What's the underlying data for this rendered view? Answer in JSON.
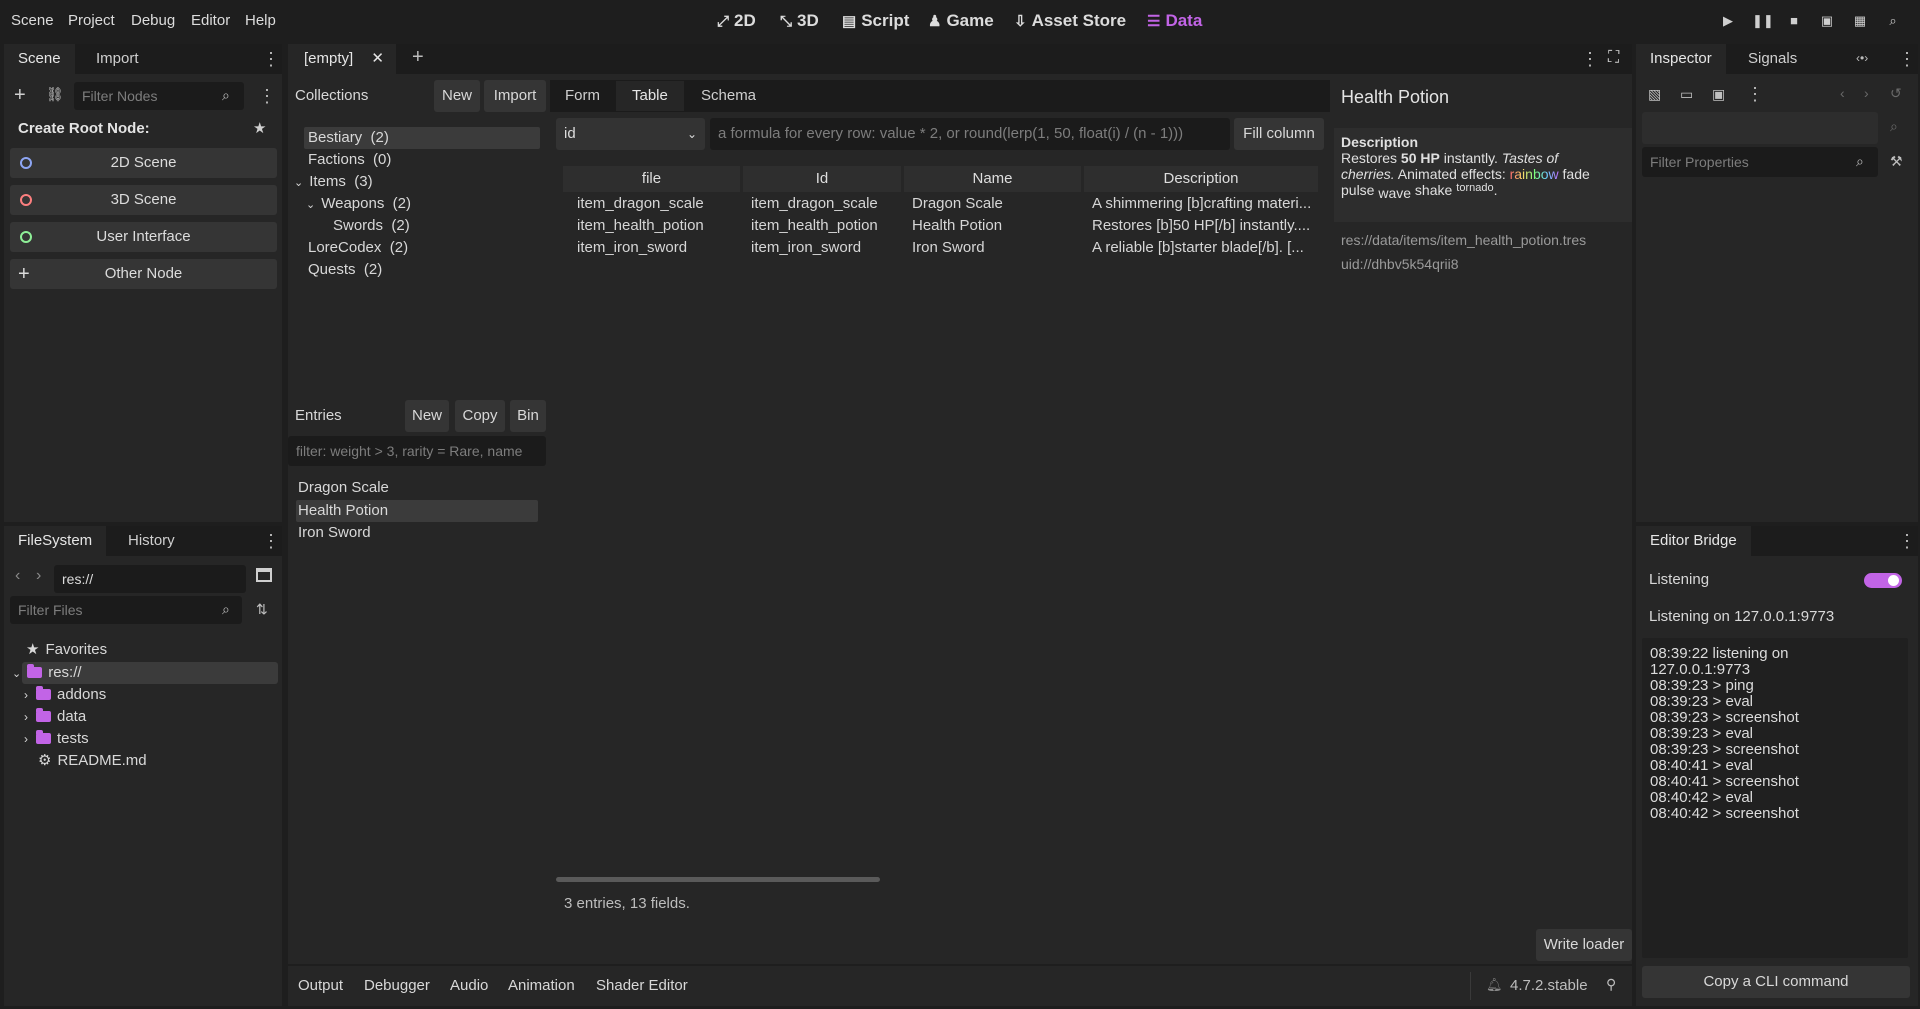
{
  "menubar": {
    "menus": [
      "Scene",
      "Project",
      "Debug",
      "Editor",
      "Help"
    ],
    "workspaces": [
      {
        "icon": "2d-icon",
        "label": "2D"
      },
      {
        "icon": "3d-icon",
        "label": "3D"
      },
      {
        "icon": "script-icon",
        "label": "Script"
      },
      {
        "icon": "game-icon",
        "label": "Game"
      },
      {
        "icon": "asset-store-icon",
        "label": "Asset Store"
      },
      {
        "icon": "data-icon",
        "label": "Data"
      }
    ],
    "accent": "#c264e6"
  },
  "scene_dock": {
    "tabs": [
      "Scene",
      "Import"
    ],
    "filter_placeholder": "Filter Nodes",
    "create_root_label": "Create Root Node:",
    "root_buttons": [
      {
        "label": "2D Scene",
        "color": "#8da5f3"
      },
      {
        "label": "3D Scene",
        "color": "#fc7f7f"
      },
      {
        "label": "User Interface",
        "color": "#8eef97"
      },
      {
        "label": "Other Node",
        "color": "#e0e0e0"
      }
    ]
  },
  "filesystem_dock": {
    "tabs": [
      "FileSystem",
      "History"
    ],
    "path": "res://",
    "filter_placeholder": "Filter Files",
    "favorites_label": "Favorites",
    "root_label": "res://",
    "items": [
      "addons",
      "data",
      "tests"
    ],
    "readme": "README.md"
  },
  "editor_tabs": {
    "current": "[empty]"
  },
  "data_editor": {
    "collections_label": "Collections",
    "new_label": "New",
    "import_label": "Import",
    "view_tabs": [
      "Form",
      "Table",
      "Schema"
    ],
    "collections": [
      {
        "label": "Bestiary",
        "count": "(2)"
      },
      {
        "label": "Factions",
        "count": "(0)"
      },
      {
        "label": "Items",
        "count": "(3)"
      },
      {
        "label": "Weapons",
        "count": "(2)"
      },
      {
        "label": "Swords",
        "count": "(2)"
      },
      {
        "label": "LoreCodex",
        "count": "(2)"
      },
      {
        "label": "Quests",
        "count": "(2)"
      }
    ],
    "entries_label": "Entries",
    "entries_new": "New",
    "entries_copy": "Copy",
    "entries_bin": "Bin",
    "entries_filter_placeholder": "filter: weight > 3, rarity = Rare, name",
    "entries": [
      "Dragon Scale",
      "Health Potion",
      "Iron Sword"
    ],
    "column_select": "id",
    "formula_placeholder": "a formula for every row: value * 2, or round(lerp(1, 50, float(i) / (n - 1)))",
    "fill_column": "Fill column",
    "table": {
      "headers": [
        "file",
        "Id",
        "Name",
        "Description"
      ],
      "rows": [
        [
          "item_dragon_scale",
          "item_dragon_scale",
          "Dragon Scale",
          "A shimmering [b]crafting materi..."
        ],
        [
          "item_health_potion",
          "item_health_potion",
          "Health Potion",
          "Restores [b]50 HP[/b] instantly...."
        ],
        [
          "item_iron_sword",
          "item_iron_sword",
          "Iron Sword",
          "A reliable [b]starter blade[/b]. [..."
        ]
      ]
    },
    "status": "3 entries, 13 fields.",
    "write_loader": "Write loader"
  },
  "preview": {
    "title": "Health Potion",
    "desc_heading": "Description",
    "desc_1a": "Restores ",
    "desc_1b": "50 HP",
    "desc_1c": " instantly. ",
    "desc_1d": "Tastes of",
    "desc_2a": "cherries.",
    "desc_2b": " Animated effects: ",
    "rainbow": "rainbow",
    "fade": " fade",
    "desc_3a": "pulse ",
    "wave": "wave",
    "shake": " shake",
    "tornado": "tornado",
    "desc_3b": ".",
    "path": "res://data/items/item_health_potion.tres",
    "uid": "uid://dhbv5k54qrii8"
  },
  "inspector": {
    "tabs": [
      "Inspector",
      "Signals"
    ],
    "filter_placeholder": "Filter Properties"
  },
  "editor_bridge": {
    "title": "Editor Bridge",
    "listening_label": "Listening",
    "listening_on": "Listening on 127.0.0.1:9773",
    "log": [
      "08:39:22  listening on",
      "127.0.0.1:9773",
      "08:39:23  > ping",
      "08:39:23  > eval",
      "08:39:23  > screenshot",
      "08:39:23  > eval",
      "08:39:23  > screenshot",
      "08:40:41  > eval",
      "08:40:41  > screenshot",
      "08:40:42  > eval",
      "08:40:42  > screenshot"
    ],
    "copy_cli": "Copy a CLI command"
  },
  "bottom_panel": {
    "tabs": [
      "Output",
      "Debugger",
      "Audio",
      "Animation",
      "Shader Editor"
    ],
    "version": "4.7.2.stable"
  }
}
